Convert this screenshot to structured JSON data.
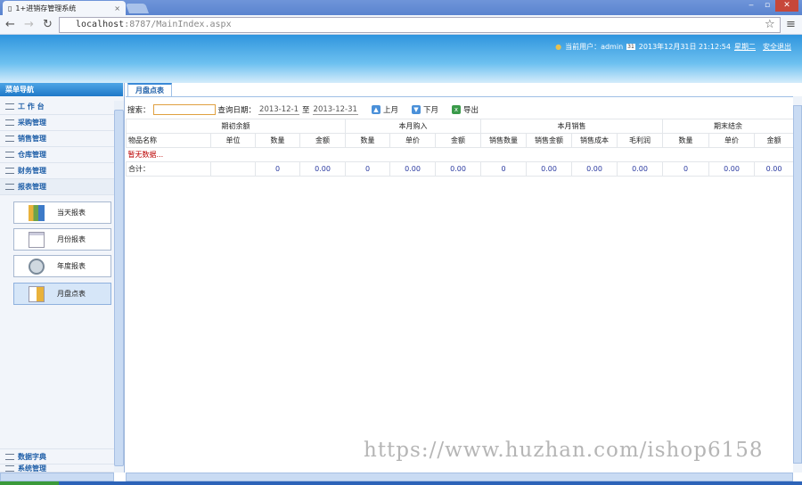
{
  "browser": {
    "tab_title": "1+进销存管理系统",
    "tab_close": "×",
    "url_host": "localhost",
    "url_rest": ":8787/MainIndex.aspx",
    "minimize": "‒",
    "maximize": "▫",
    "close": "✕",
    "star": "☆",
    "menu": "≡"
  },
  "header": {
    "user_label": "当前用户：admin",
    "datetime": "2013年12月31日 21:12:54",
    "weekday": "星期二",
    "logout": "安全退出"
  },
  "sidebar": {
    "title": "菜单导航",
    "items": [
      {
        "label": "工 作 台"
      },
      {
        "label": "采购管理"
      },
      {
        "label": "销售管理"
      },
      {
        "label": "仓库管理"
      },
      {
        "label": "财务管理"
      },
      {
        "label": "报表管理"
      }
    ],
    "reports": [
      {
        "label": "当天报表"
      },
      {
        "label": "月份报表"
      },
      {
        "label": "年度报表"
      },
      {
        "label": "月盘点表",
        "selected": true
      }
    ],
    "bottom_items": [
      {
        "label": "数据字典"
      },
      {
        "label": "系统管理"
      }
    ]
  },
  "main": {
    "tab": "月盘点表",
    "search_label": "搜索：",
    "search_value": "",
    "date_label": "查询日期：",
    "date_from": "2013-12-1",
    "date_sep": "至",
    "date_to": "2013-12-31",
    "prev_month": "上月",
    "next_month": "下月",
    "export": "导出",
    "groups": [
      "期初余额",
      "本月购入",
      "本月销售",
      "期末结余"
    ],
    "columns": [
      "物品名称",
      "单位",
      "数量",
      "金额",
      "数量",
      "单价",
      "金额",
      "销售数量",
      "销售金额",
      "销售成本",
      "毛利润",
      "数量",
      "单价",
      "金额"
    ],
    "no_data": "暂无数据...",
    "total_label": "合计：",
    "totals": [
      "",
      "0",
      "0.00",
      "0",
      "0.00",
      "0.00",
      "0",
      "0.00",
      "0.00",
      "0.00",
      "0",
      "0.00",
      "0.00"
    ]
  },
  "watermark": "https://www.huzhan.com/ishop6158"
}
